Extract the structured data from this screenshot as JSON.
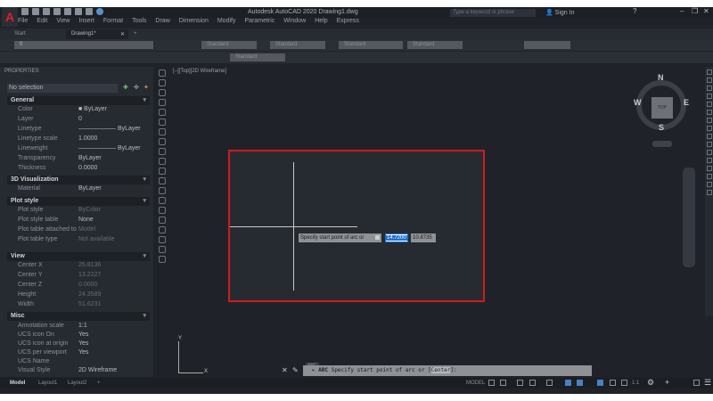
{
  "app": {
    "title": "Autodesk AutoCAD 2020    Drawing1.dwg",
    "logo": "A",
    "search_placeholder": "Type a keyword or phrase",
    "sign_in": "Sign In"
  },
  "menu": [
    "File",
    "Edit",
    "View",
    "Insert",
    "Format",
    "Tools",
    "Draw",
    "Dimension",
    "Modify",
    "Parametric",
    "Window",
    "Help",
    "Express"
  ],
  "doc_tabs": [
    {
      "label": "Start"
    },
    {
      "label": "Drawing1*",
      "active": true
    }
  ],
  "toolbar": {
    "layer": "0",
    "styles": [
      "Standard",
      "Standard",
      "Standard",
      "Standard",
      "Standard"
    ]
  },
  "properties": {
    "title": "PROPERTIES",
    "selection": "No selection",
    "sections": [
      {
        "title": "General",
        "rows": [
          [
            "Color",
            "■ ByLayer"
          ],
          [
            "Layer",
            "0"
          ],
          [
            "Linetype",
            "——————  ByLayer"
          ],
          [
            "Linetype scale",
            "1.0000"
          ],
          [
            "Lineweight",
            "——————  ByLayer"
          ],
          [
            "Transparency",
            "ByLayer"
          ],
          [
            "Thickness",
            "0.0000"
          ]
        ]
      },
      {
        "title": "3D Visualization",
        "rows": [
          [
            "Material",
            "ByLayer"
          ]
        ]
      },
      {
        "title": "Plot style",
        "rows": [
          [
            "Plot style",
            "ByColor"
          ],
          [
            "Plot style table",
            "None"
          ],
          [
            "Plot table attached to",
            "Model"
          ],
          [
            "Plot table type",
            "Not available"
          ]
        ]
      },
      {
        "title": "View",
        "rows": [
          [
            "Center X",
            "25.8136"
          ],
          [
            "Center Y",
            "13.2227"
          ],
          [
            "Center Z",
            "0.0000"
          ],
          [
            "Height",
            "24.3589"
          ],
          [
            "Width",
            "51.6231"
          ]
        ]
      },
      {
        "title": "Misc",
        "rows": [
          [
            "Annotation scale",
            "1:1"
          ],
          [
            "UCS icon On",
            "Yes"
          ],
          [
            "UCS icon at origin",
            "Yes"
          ],
          [
            "UCS per viewport",
            "Yes"
          ],
          [
            "UCS Name",
            ""
          ],
          [
            "Visual Style",
            "2D Wireframe"
          ]
        ]
      }
    ]
  },
  "viewport": {
    "label": "[–][Top][2D Wireframe]",
    "tooltip": "Specify start point of arc or",
    "input_x": "14.7200",
    "input_y": "10.8735",
    "highlight_color": "#d11a1a"
  },
  "viewcube": {
    "top": "TOP",
    "n": "N",
    "s": "S",
    "e": "E",
    "w": "W"
  },
  "ucs": {
    "x": "X",
    "y": "Y"
  },
  "command": {
    "history": "ARC",
    "name": "ARC",
    "prompt": "Specify start point of arc or [",
    "option": "Center",
    "end": "]:"
  },
  "layout_tabs": [
    "Model",
    "Layout1",
    "Layout2",
    "+"
  ],
  "status": {
    "model": "MODEL",
    "scale": "1:1"
  }
}
